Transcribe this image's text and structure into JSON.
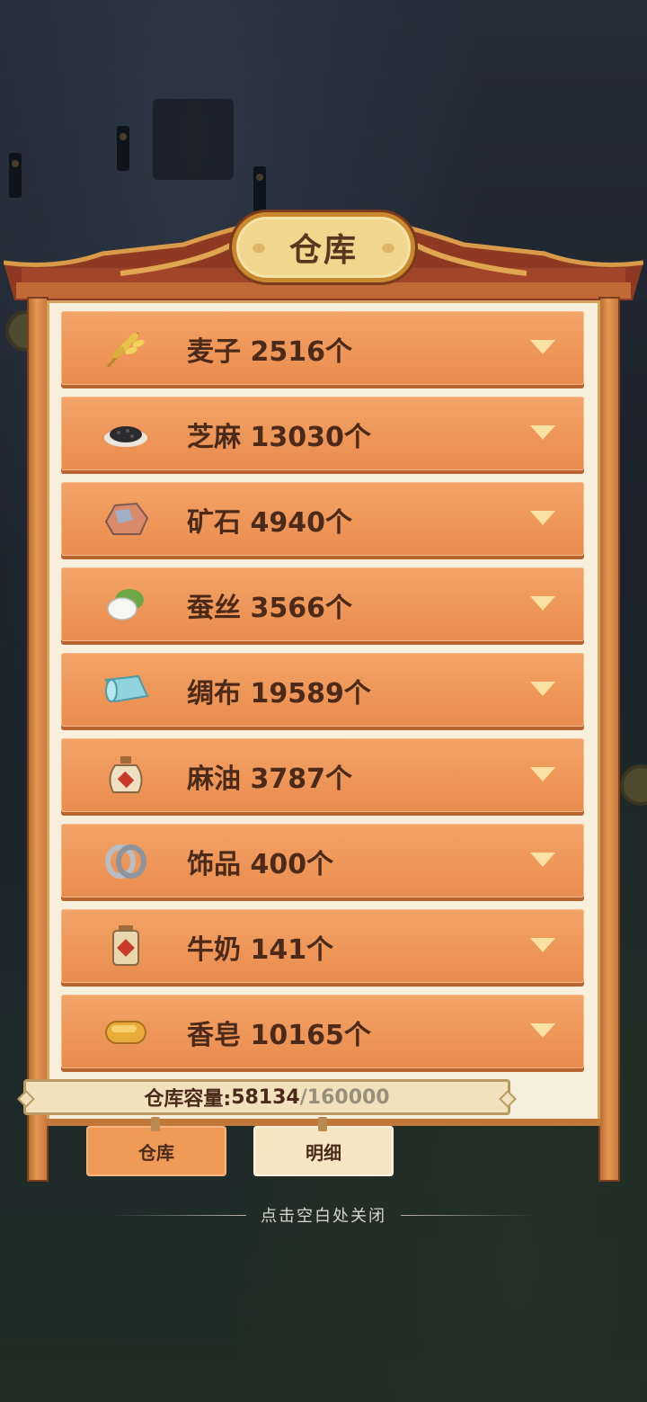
{
  "header": {
    "title": "仓库"
  },
  "items": [
    {
      "label": "麦子 2516个",
      "icon": "wheat-icon"
    },
    {
      "label": "芝麻 13030个",
      "icon": "sesame-icon"
    },
    {
      "label": "矿石 4940个",
      "icon": "ore-icon"
    },
    {
      "label": "蚕丝 3566个",
      "icon": "silk-cocoon-icon"
    },
    {
      "label": "绸布 19589个",
      "icon": "cloth-roll-icon"
    },
    {
      "label": "麻油 3787个",
      "icon": "oil-jar-icon"
    },
    {
      "label": "饰品 400个",
      "icon": "rings-icon"
    },
    {
      "label": "牛奶 141个",
      "icon": "milk-jar-icon"
    },
    {
      "label": "香皂 10165个",
      "icon": "soap-icon"
    }
  ],
  "capacity": {
    "label": "仓库容量:",
    "used": "58134",
    "max": "/160000"
  },
  "tabs": {
    "warehouse": "仓库",
    "details": "明细"
  },
  "close_hint": "点击空白处关闭",
  "colors": {
    "row": "#ee9658",
    "panel": "#f8efdc",
    "active_tab": "#f09a57"
  }
}
